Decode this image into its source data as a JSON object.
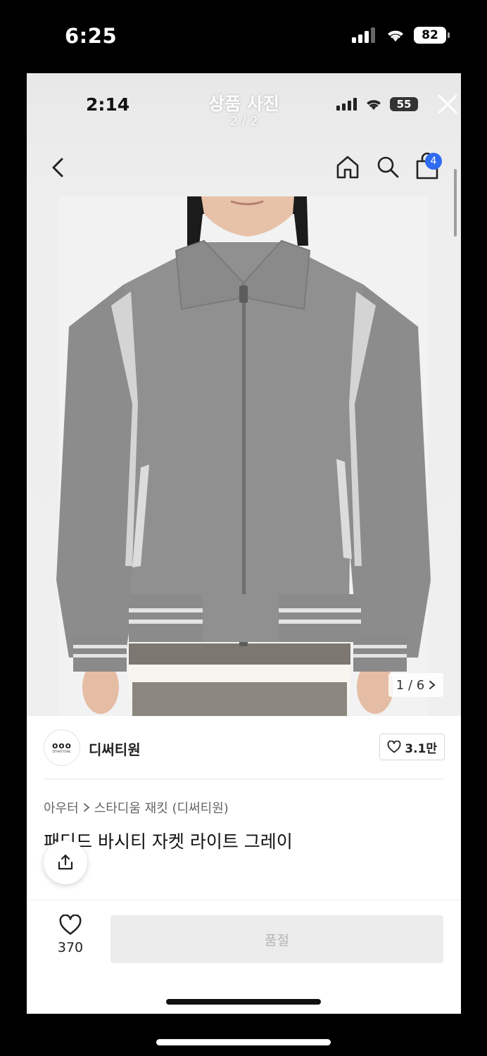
{
  "outer_status": {
    "time": "6:25",
    "battery": "82"
  },
  "viewer": {
    "time": "2:14",
    "title": "상품 사진",
    "counter": "2 / 2",
    "battery": "55"
  },
  "nav": {
    "cart_count": "4"
  },
  "photo": {
    "page_indicator": "1 / 6"
  },
  "brand": {
    "logo_text": "ооо",
    "logo_subtext": "DTHIRTYONE.",
    "name": "디써티원",
    "likes": "3.1만"
  },
  "breadcrumb": {
    "category": "아우터",
    "subcategory": "스타디움 재킷 (디써티원)"
  },
  "product": {
    "title": "패디드 바시티 자켓 라이트 그레이"
  },
  "bottom": {
    "wish_count": "370",
    "cta_label": "품절"
  },
  "colors": {
    "accent": "#2f6bf0",
    "jacket": "#8e8e8e",
    "disabled_bg": "#ececec"
  },
  "icons": [
    "back-chevron-icon",
    "home-icon",
    "search-icon",
    "shopping-bag-icon",
    "close-icon",
    "heart-icon",
    "share-icon",
    "chevron-right-icon"
  ]
}
